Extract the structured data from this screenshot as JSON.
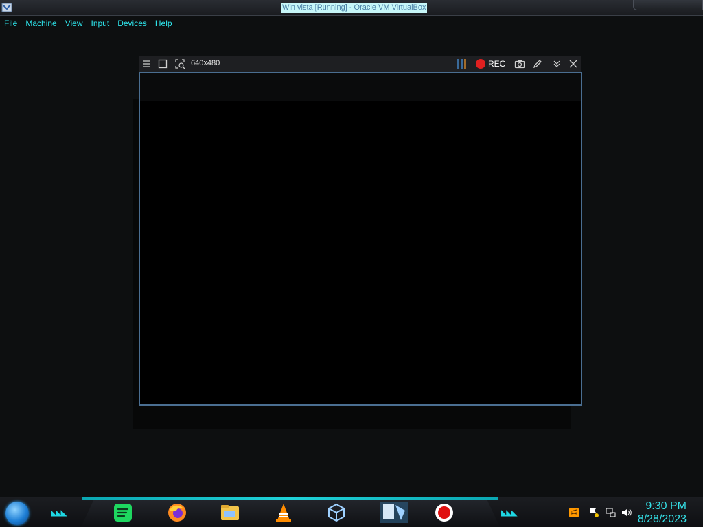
{
  "window": {
    "title": "Win vista [Running] - Oracle VM VirtualBox",
    "menu": [
      "File",
      "Machine",
      "View",
      "Input",
      "Devices",
      "Help"
    ]
  },
  "recorder": {
    "resolution": "640x480",
    "rec_label": "REC"
  },
  "taskbar": {
    "apps": [
      "spotify-icon",
      "firefox-icon",
      "file-explorer-icon",
      "vlc-icon",
      "virtualbox-icon",
      "vista-vm-icon",
      "screen-recorder-icon"
    ],
    "tray": [
      "sublime-text-icon",
      "action-center-flag-icon",
      "network-icon",
      "volume-icon"
    ],
    "clock": {
      "time": "9:30 PM",
      "date": "8/28/2023"
    }
  },
  "colors": {
    "accent": "#2ee5ec",
    "rec": "#e02020",
    "frame_border": "#4a6e91"
  }
}
